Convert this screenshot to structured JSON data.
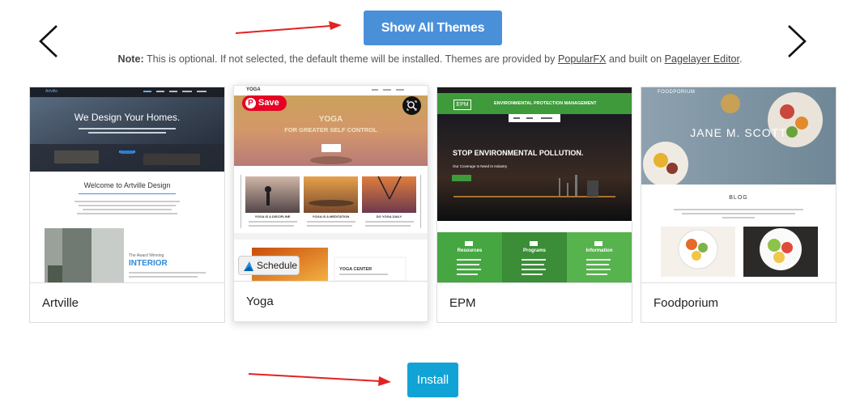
{
  "header": {
    "show_all_label": "Show All Themes"
  },
  "note": {
    "prefix": "Note:",
    "text": " This is optional. If not selected, the default theme will be installed. Themes are provided by ",
    "link1": "PopularFX",
    "middle": " and built on ",
    "link2": "Pagelayer Editor",
    "suffix": "."
  },
  "themes": [
    {
      "name": "Artville",
      "preview": {
        "logo": "Artville",
        "hero_title": "We Design Your Homes.",
        "welcome": "Welcome to Artville Design",
        "award": "The Award Winning",
        "interior": "INTERIOR"
      }
    },
    {
      "name": "Yoga",
      "preview": {
        "logo": "YOGA",
        "hero_title": "YOGA",
        "hero_subtitle": "FOR GREATER SELF CONTROL",
        "tiles": [
          "YOGA IS A DISCIPLINE",
          "YOGA IS A MEDITATION",
          "DO YOGA DAILY"
        ],
        "center_title": "YOGA CENTER",
        "save_label": "Save",
        "schedule_label": "Schedule"
      }
    },
    {
      "name": "EPM",
      "preview": {
        "logo": "EPM",
        "header_title": "ENVIRONMENTAL PROTECTION MANAGEMENT",
        "hero_title": "STOP ENVIRONMENTAL POLLUTION.",
        "hero_subtitle": "Our Coverage Is Need In Industry",
        "cols": [
          "Resources",
          "Programs",
          "Information"
        ]
      }
    },
    {
      "name": "Foodporium",
      "preview": {
        "logo": "FOODPORIUM",
        "hero_title": "JANE M. SCOTT",
        "section": "BLOG"
      }
    }
  ],
  "footer": {
    "install_label": "Install"
  },
  "colors": {
    "show_all_bg": "#4a90d9",
    "install_bg": "#11a3d6",
    "pinterest": "#e60023",
    "epm_green": "#3f9a3b"
  }
}
